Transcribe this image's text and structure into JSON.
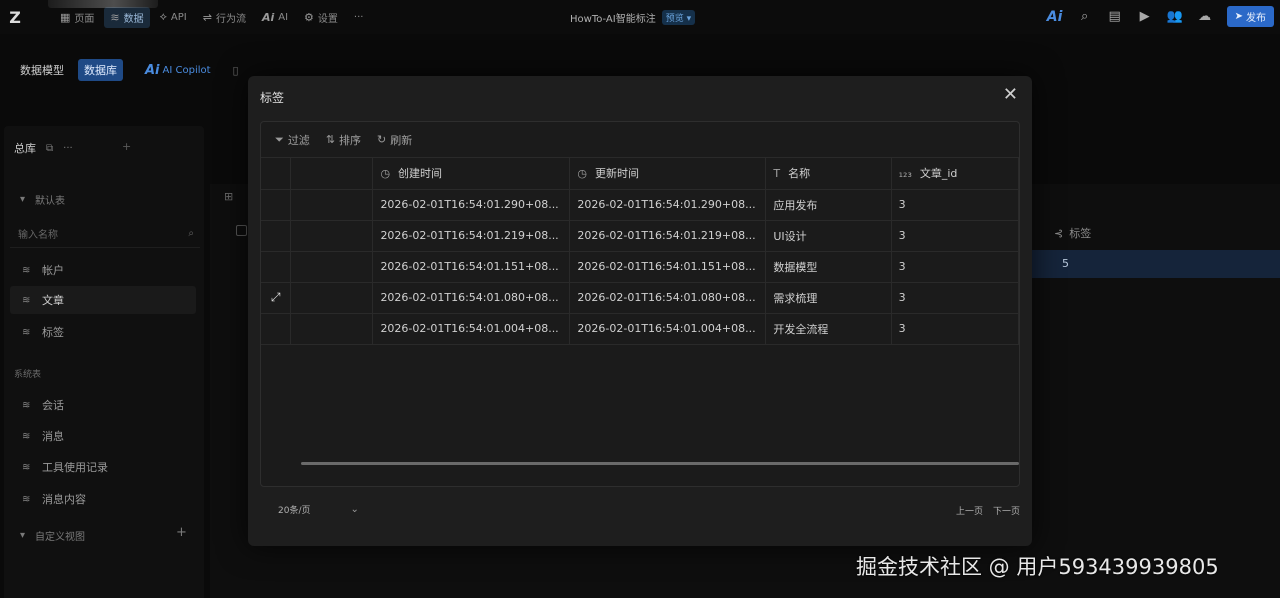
{
  "topbar": {
    "nav": [
      {
        "icon": "grid-icon",
        "glyph": "▦",
        "label": "页面"
      },
      {
        "icon": "database-icon",
        "glyph": "≋",
        "label": "数据",
        "active": true
      },
      {
        "icon": "api-icon",
        "glyph": "⟡",
        "label": "API"
      },
      {
        "icon": "workflow-icon",
        "glyph": "⚙",
        "label": "行为流"
      },
      {
        "icon": "ai-icon",
        "glyph": "Ai",
        "label": "AI"
      },
      {
        "icon": "settings-icon",
        "glyph": "⚙",
        "label": "设置"
      }
    ],
    "more": "···",
    "project_title": "HowTo-AI智能标注",
    "env_badge": "预览 ▾",
    "publish_label": "发布"
  },
  "subbar": {
    "tab_model": "数据模型",
    "tab_db": "数据库",
    "copilot_ai": "Ai",
    "copilot_label": "AI Copilot"
  },
  "sidebar": {
    "head_label": "总库",
    "default_group": "默认表",
    "search_placeholder": "输入名称",
    "default_items": [
      "帐户",
      "文章",
      "标签"
    ],
    "system_group": "系统表",
    "system_items": [
      "会话",
      "消息",
      "工具使用记录",
      "消息内容"
    ],
    "custom_group": "自定义视图"
  },
  "background": {
    "column_tag": "标签",
    "selected_value": "5"
  },
  "modal": {
    "title": "标签",
    "toolbar": {
      "filter": "过滤",
      "sort": "排序",
      "refresh": "刷新"
    },
    "columns": [
      "创建时间",
      "更新时间",
      "名称",
      "文章_id"
    ],
    "rows": [
      {
        "created": "2026-02-01T16:54:01.290+08...",
        "updated": "2026-02-01T16:54:01.290+08...",
        "name": "应用发布",
        "article_id": "3"
      },
      {
        "created": "2026-02-01T16:54:01.219+08...",
        "updated": "2026-02-01T16:54:01.219+08...",
        "name": "UI设计",
        "article_id": "3"
      },
      {
        "created": "2026-02-01T16:54:01.151+08...",
        "updated": "2026-02-01T16:54:01.151+08...",
        "name": "数据模型",
        "article_id": "3"
      },
      {
        "created": "2026-02-01T16:54:01.080+08...",
        "updated": "2026-02-01T16:54:01.080+08...",
        "name": "需求梳理",
        "article_id": "3"
      },
      {
        "created": "2026-02-01T16:54:01.004+08...",
        "updated": "2026-02-01T16:54:01.004+08...",
        "name": "开发全流程",
        "article_id": "3"
      }
    ],
    "page_size": "20条/页",
    "prev_page": "上一页",
    "next_page": "下一页"
  },
  "watermark": "掘金技术社区 @ 用户593439939805"
}
